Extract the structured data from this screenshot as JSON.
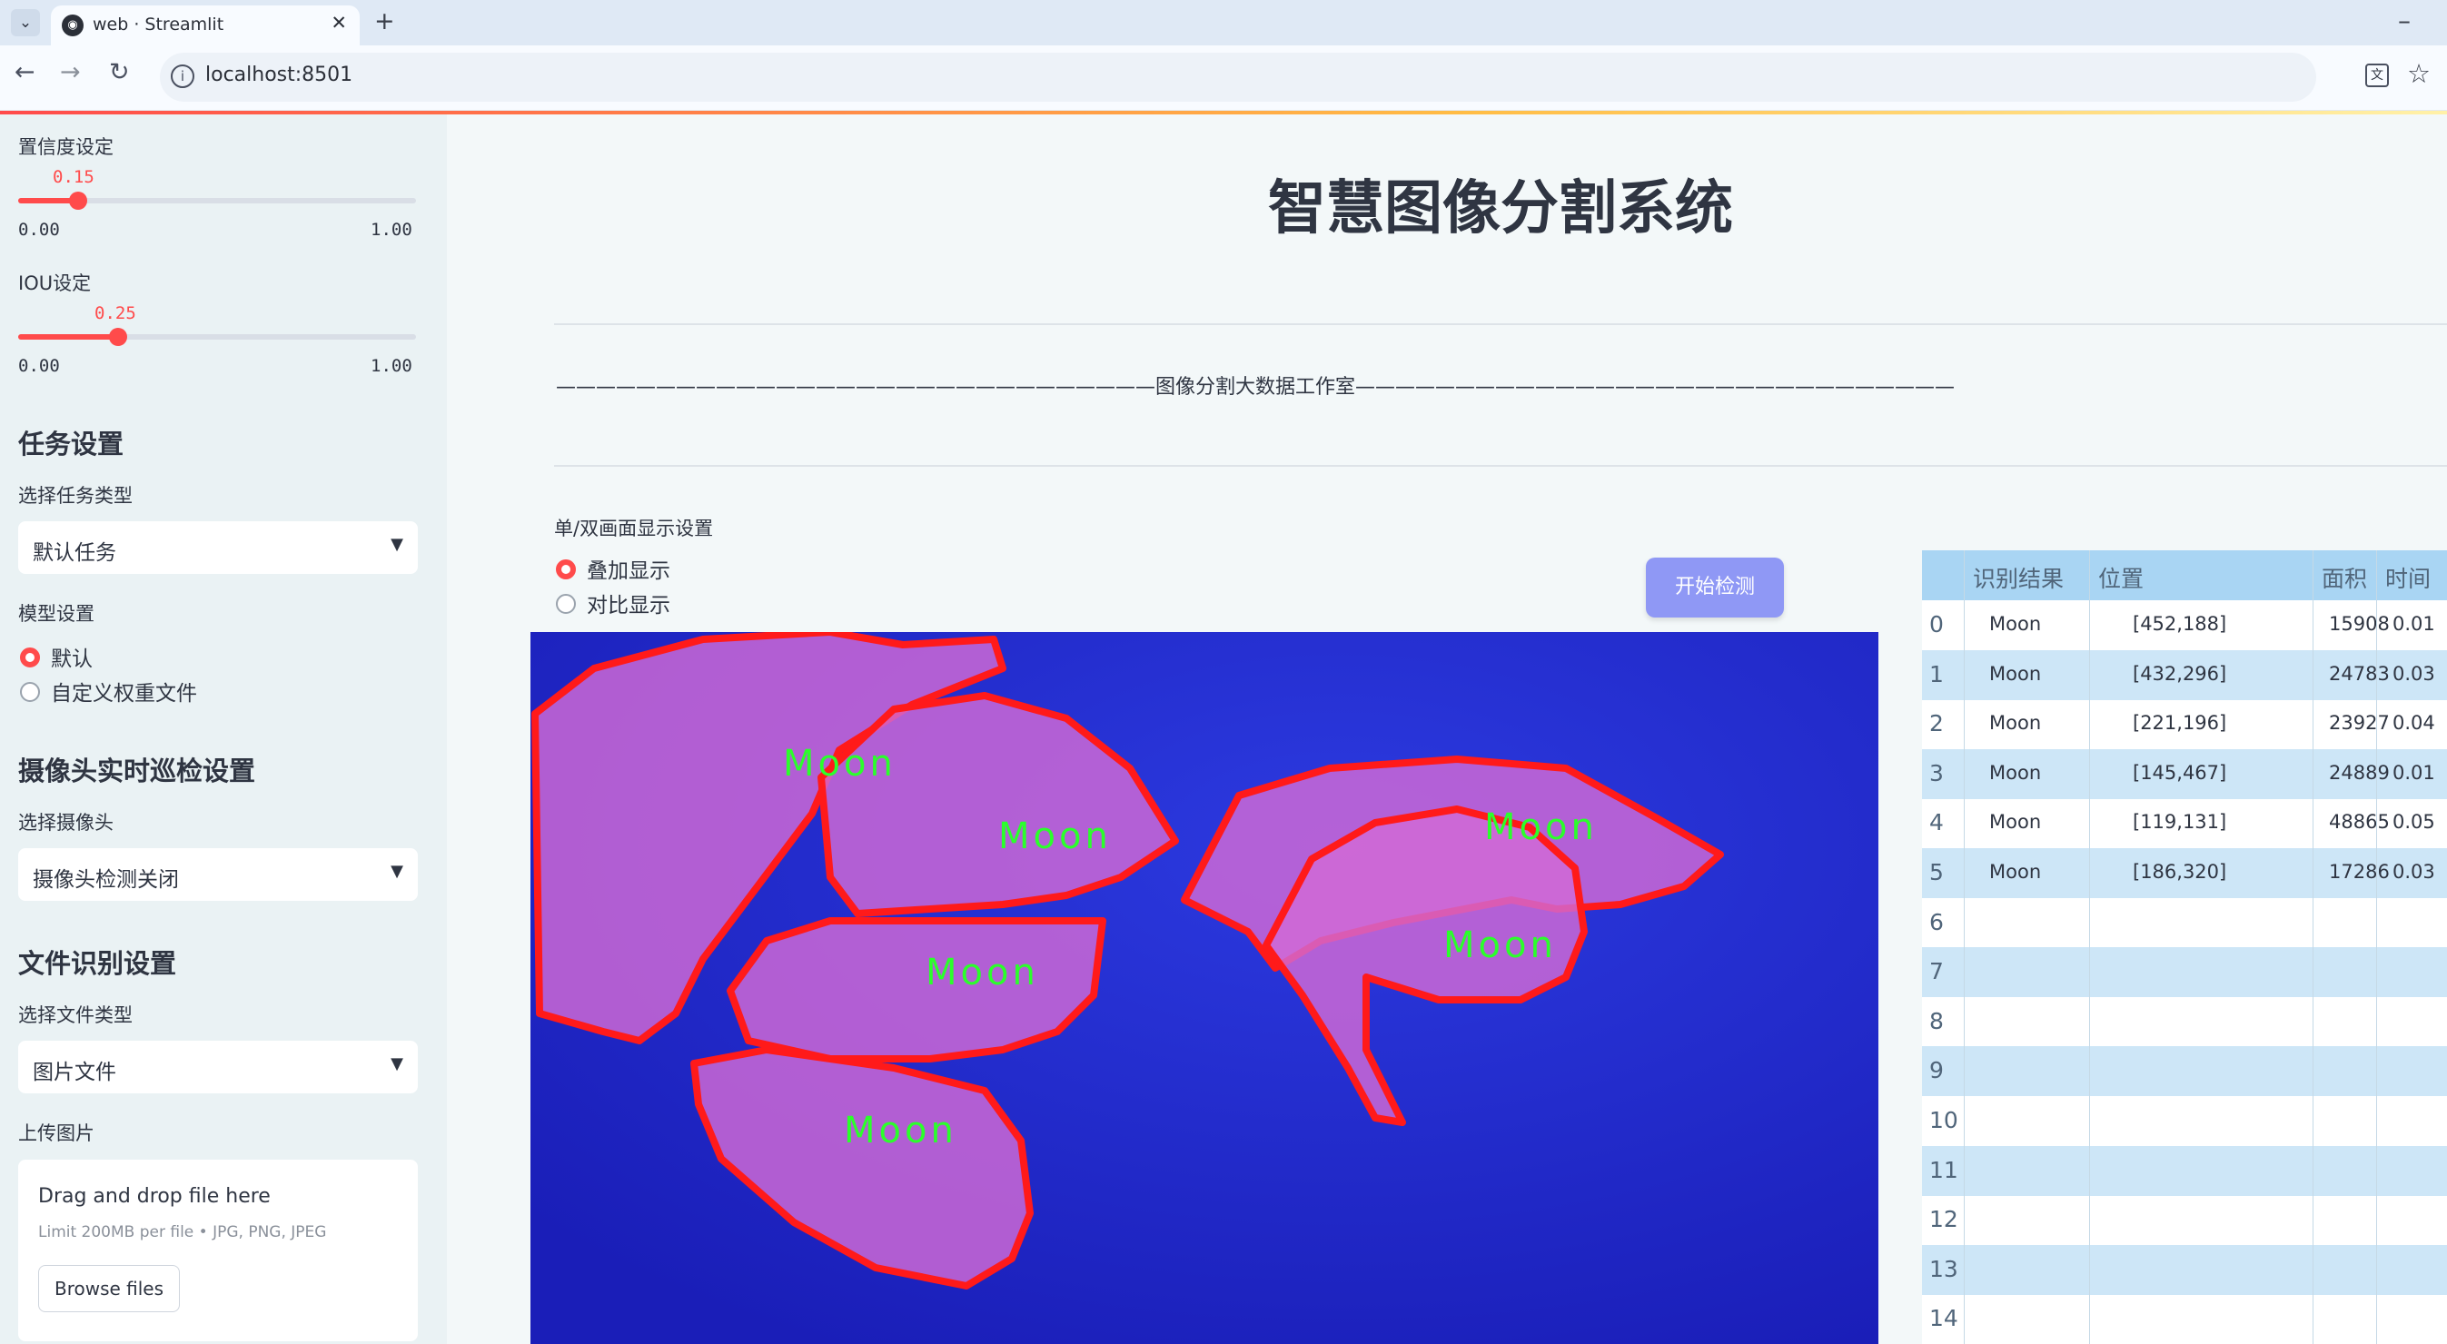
{
  "browser": {
    "tab_title": "web · Streamlit",
    "url": "localhost:8501"
  },
  "sidebar": {
    "confidence": {
      "label": "置信度设定",
      "value": "0.15",
      "min": "0.00",
      "max": "1.00",
      "fraction": 0.15
    },
    "iou": {
      "label": "IOU设定",
      "value": "0.25",
      "min": "0.00",
      "max": "1.00",
      "fraction": 0.25
    },
    "task": {
      "heading": "任务设置",
      "select_label": "选择任务类型",
      "selected": "默认任务"
    },
    "model": {
      "label": "模型设置",
      "options": [
        "默认",
        "自定义权重文件"
      ],
      "selected_index": 0
    },
    "camera": {
      "heading": "摄像头实时巡检设置",
      "select_label": "选择摄像头",
      "selected": "摄像头检测关闭"
    },
    "file": {
      "heading": "文件识别设置",
      "select_label": "选择文件类型",
      "selected": "图片文件"
    },
    "upload": {
      "label": "上传图片",
      "drop_text": "Drag and drop file here",
      "limit_text": "Limit 200MB per file • JPG, PNG, JPEG",
      "browse_label": "Browse files"
    }
  },
  "main": {
    "title": "智慧图像分割系统",
    "divider_text": "——————————————————————————————图像分割大数据工作室——————————————————————————————",
    "display": {
      "label": "单/双画面显示设置",
      "options": [
        "叠加显示",
        "对比显示"
      ],
      "selected_index": 0
    },
    "start_button": "开始检测",
    "detections": [
      "Moon",
      "Moon",
      "Moon",
      "Moon",
      "Moon",
      "Moon"
    ]
  },
  "table": {
    "headers": [
      "识别结果",
      "位置",
      "面积",
      "时间"
    ],
    "row_indices": [
      "0",
      "1",
      "2",
      "3",
      "4",
      "5",
      "6",
      "7",
      "8",
      "9",
      "10",
      "11",
      "12",
      "13",
      "14"
    ],
    "rows": [
      [
        "Moon",
        "[452,188]",
        "15908",
        "0.01"
      ],
      [
        "Moon",
        "[432,296]",
        "24783",
        "0.03"
      ],
      [
        "Moon",
        "[221,196]",
        "23927",
        "0.04"
      ],
      [
        "Moon",
        "[145,467]",
        "24889",
        "0.01"
      ],
      [
        "Moon",
        "[119,131]",
        "48865",
        "0.05"
      ],
      [
        "Moon",
        "[186,320]",
        "17286",
        "0.03"
      ]
    ]
  },
  "colors": {
    "accent": "#ff4b4b",
    "button": "#8f98f5",
    "table_header": "#a9d5f3",
    "table_alt": "#cde6f7",
    "mask_outline": "#ff1a1a",
    "mask_fill": "#d26ad6",
    "label_text": "#2bff2b",
    "water": "#1e22c8"
  }
}
